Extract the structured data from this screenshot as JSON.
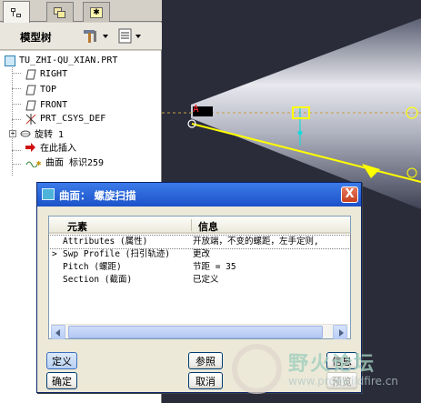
{
  "model_tree": {
    "title": "模型树",
    "nodes": [
      {
        "label": "TU_ZHI-QU_XIAN.PRT",
        "icon": "part-icon"
      },
      {
        "label": "RIGHT",
        "icon": "datum-plane-icon"
      },
      {
        "label": "TOP",
        "icon": "datum-plane-icon"
      },
      {
        "label": "FRONT",
        "icon": "datum-plane-icon"
      },
      {
        "label": "PRT_CSYS_DEF",
        "icon": "csys-icon"
      },
      {
        "label": "旋转 1",
        "icon": "revolve-icon"
      },
      {
        "label": "在此插入",
        "icon": "insert-arrow-icon"
      },
      {
        "label": "曲面 标识259",
        "icon": "surface-icon"
      }
    ]
  },
  "graphics": {
    "csys_label": "A"
  },
  "dialog": {
    "title": "曲面： 螺旋扫描",
    "columns": [
      "元素",
      "信息"
    ],
    "rows": [
      {
        "element": "Attributes (属性)",
        "info": "开放端，不变的螺距，左手定则,"
      },
      {
        "element": "Swp Profile (扫引轨迹)",
        "info": "更改"
      },
      {
        "element": "Pitch (螺距)",
        "info": "节距 = 35"
      },
      {
        "element": "Section (截面)",
        "info": "已定义"
      }
    ],
    "buttons": {
      "define": "定义",
      "ok": "确定",
      "refs": "参照",
      "info": "信息",
      "cancel": "取消",
      "preview": "预览"
    },
    "close_glyph": "X"
  },
  "watermark": {
    "text": "野火论坛",
    "url": "www.proewildfire.cn"
  },
  "colors": {
    "title_bar": "#2a5fd6",
    "viewport_bg": "#2b2c3a",
    "highlight": "#ffff00"
  }
}
